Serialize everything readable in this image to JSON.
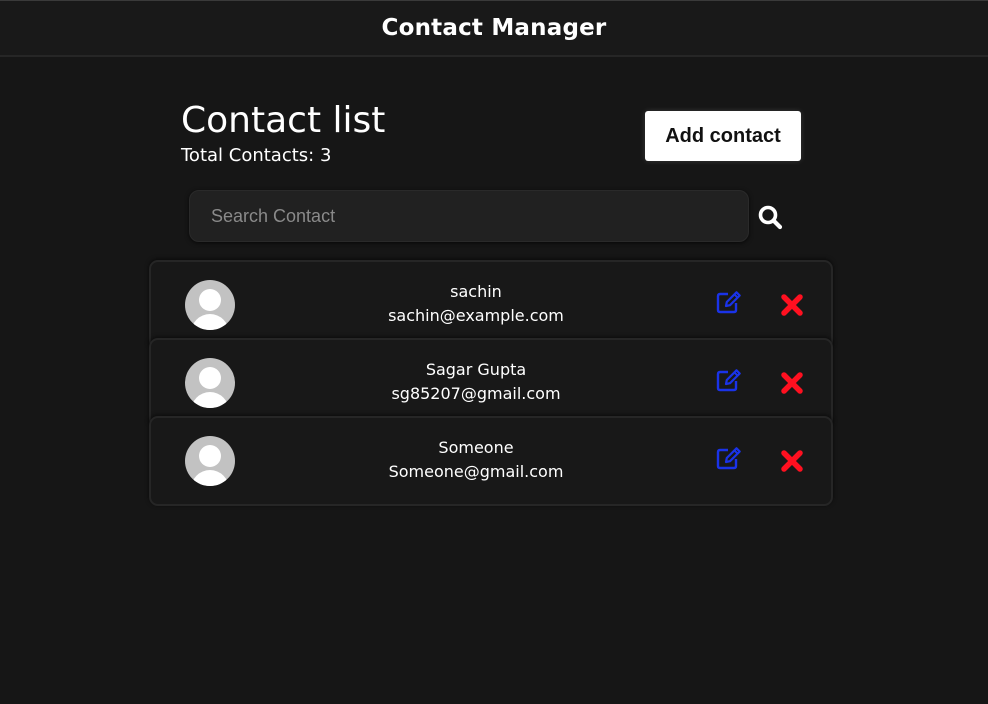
{
  "header": {
    "title": "Contact Manager"
  },
  "main": {
    "heading": "Contact list",
    "total_label": "Total Contacts: 3",
    "add_button_label": "Add contact"
  },
  "search": {
    "placeholder": "Search Contact",
    "value": ""
  },
  "contacts": [
    {
      "name": "sachin",
      "email": "sachin@example.com"
    },
    {
      "name": "Sagar Gupta",
      "email": "sg85207@gmail.com"
    },
    {
      "name": "Someone",
      "email": "Someone@gmail.com"
    }
  ],
  "icons": {
    "search": "search-icon",
    "edit": "edit-icon",
    "delete": "delete-icon",
    "avatar": "user-avatar-icon"
  },
  "colors": {
    "background": "#161616",
    "edit_icon": "#1a33e8",
    "delete_icon": "#ff1020",
    "button_bg": "#ffffff"
  }
}
